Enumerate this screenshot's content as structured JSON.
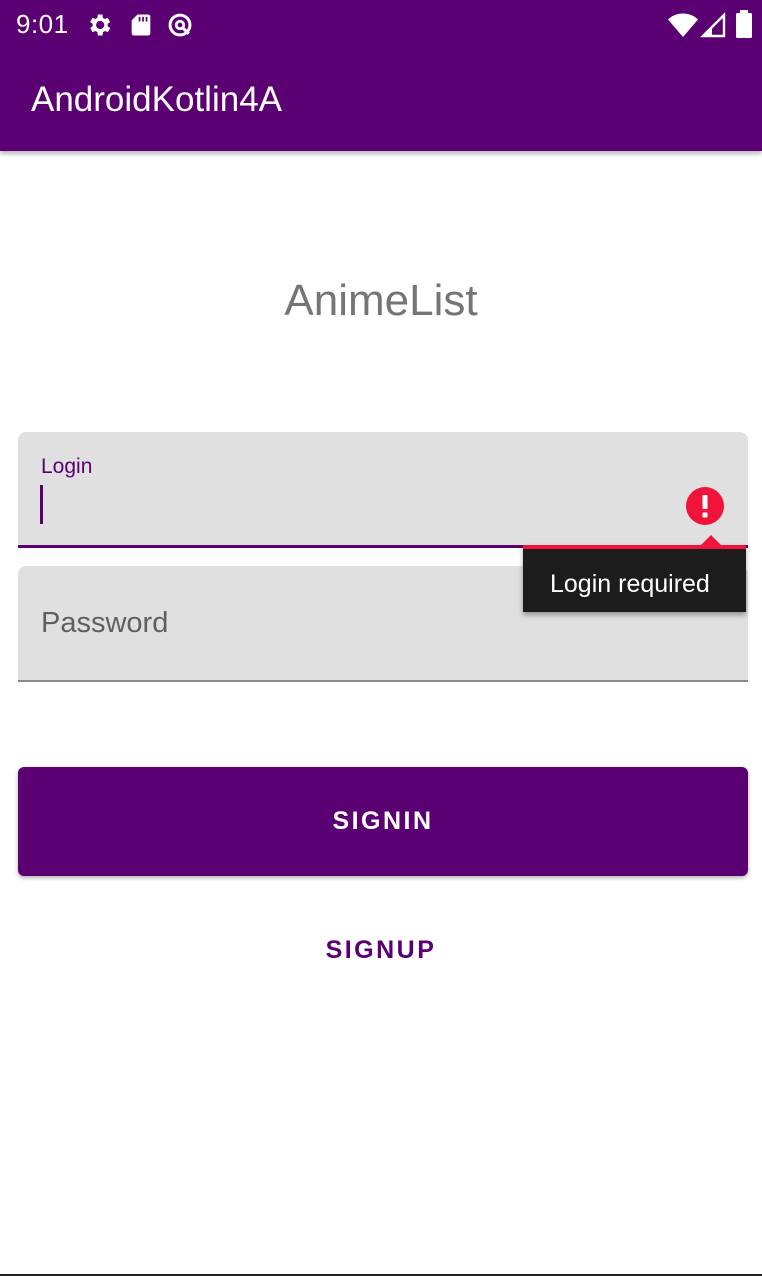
{
  "status_bar": {
    "time": "9:01",
    "icons": [
      "gear-icon",
      "sd-card-icon",
      "rotation-lock-icon",
      "wifi-icon",
      "signal-icon",
      "battery-icon"
    ]
  },
  "app_bar": {
    "title": "AndroidKotlin4A"
  },
  "screen": {
    "title": "AnimeList"
  },
  "login_field": {
    "label": "Login",
    "value": "",
    "error": "Login required",
    "error_icon": "error-icon"
  },
  "password_field": {
    "placeholder": "Password",
    "value": ""
  },
  "buttons": {
    "signin": "SIGNIN",
    "signup": "SIGNUP"
  },
  "colors": {
    "primary": "#5b0072",
    "error": "#f0133a",
    "field_background": "#e0e0e0",
    "tooltip_background": "#1c1c1c"
  }
}
